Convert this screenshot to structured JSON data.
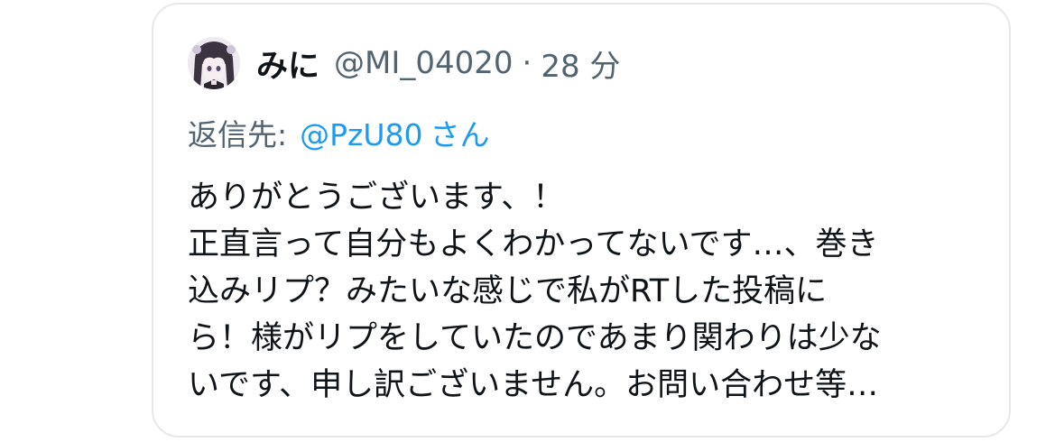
{
  "tweet": {
    "display_name": "みに",
    "handle": "@MI_04020",
    "separator": "·",
    "time": "28 分",
    "reply_label": "返信先:",
    "reply_to": "@PzU80",
    "reply_suffix": "さん",
    "lines": [
      "ありがとうございます、！",
      "正直言って自分もよくわかってないです…、巻き",
      "込みリプ？みたいな感じで私がRTした投稿に",
      "ら！様がリプをしていたのであまり関わりは少な",
      "いです、申し訳ございません。お問い合わせ等…"
    ]
  },
  "colors": {
    "text": "#0f1419",
    "secondary": "#536471",
    "link": "#1d9bf0",
    "border": "#e6e9ec"
  },
  "icons": {
    "avatar": "avatar-anime-girl"
  }
}
